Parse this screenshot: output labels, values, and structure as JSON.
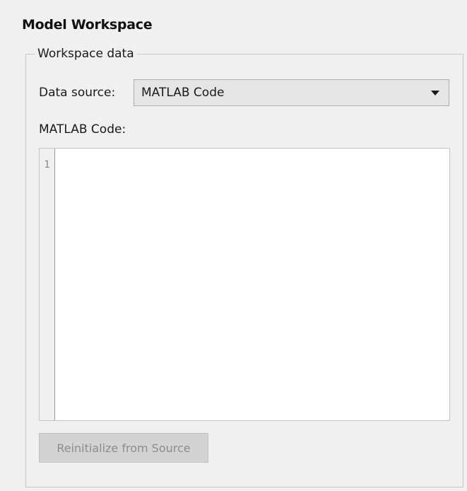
{
  "panel": {
    "title": "Model Workspace"
  },
  "workspace_data": {
    "group_label": "Workspace data",
    "data_source_label": "Data source:",
    "data_source_value": "MATLAB Code",
    "code_label": "MATLAB Code:",
    "code_line_numbers": [
      "1"
    ],
    "code_text": "",
    "reinitialize_button_label": "Reinitialize from Source",
    "reinitialize_button_enabled": false
  },
  "icons": {
    "dropdown": "chevron-down-icon"
  }
}
